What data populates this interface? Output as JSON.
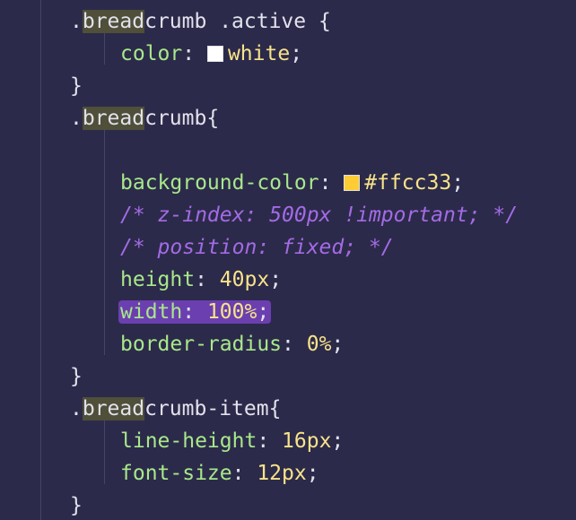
{
  "code_lines": [
    {
      "selector_prefix": ".",
      "selector_match": "bread",
      "selector_rest": "crumb .active",
      "brace": " {"
    },
    {
      "property": "color",
      "value": "white",
      "swatch_color": "#ffffff"
    },
    {
      "close": "}"
    },
    {
      "selector_prefix": ".",
      "selector_match": "bread",
      "selector_rest": "crumb",
      "brace": "{"
    },
    {
      "blank": ""
    },
    {
      "property": "background-color",
      "value": "#ffcc33",
      "swatch_color": "#ffcc33"
    },
    {
      "comment": "/* z-index: 500px !important; */"
    },
    {
      "comment": "/* position: fixed; */"
    },
    {
      "property": "height",
      "value": "40px"
    },
    {
      "property": "width",
      "value": "100%",
      "selected": true
    },
    {
      "property": "border-radius",
      "value": "0%"
    },
    {
      "close": "}"
    },
    {
      "selector_prefix": ".",
      "selector_match": "bread",
      "selector_rest": "crumb-item",
      "brace": "{"
    },
    {
      "property": "line-height",
      "value": "16px"
    },
    {
      "property": "font-size",
      "value": "12px"
    },
    {
      "close": "}"
    }
  ],
  "colors": {
    "background": "#2c2a4a",
    "property": "#a8e88a",
    "value": "#f7e38a",
    "comment": "#a36be6",
    "selection": "#6b3fb0",
    "match_highlight": "#4f4f3a"
  }
}
